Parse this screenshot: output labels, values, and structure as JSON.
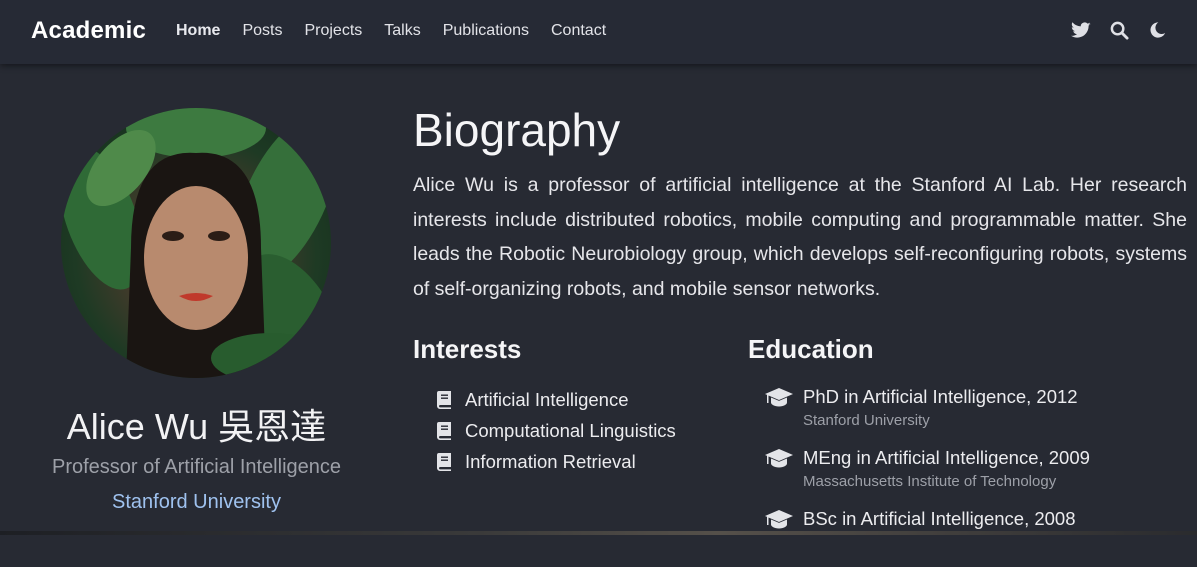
{
  "brand": "Academic",
  "nav": {
    "links": [
      "Home",
      "Posts",
      "Projects",
      "Talks",
      "Publications",
      "Contact"
    ],
    "active": "Home",
    "icons": [
      "twitter-icon",
      "search-icon",
      "moon-icon"
    ]
  },
  "profile": {
    "name": "Alice Wu 吳恩達",
    "role": "Professor of Artificial Intelligence",
    "organization": "Stanford University"
  },
  "biography": {
    "title": "Biography",
    "text": "Alice Wu is a professor of artificial intelligence at the Stanford AI Lab. Her research interests include distributed robotics, mobile computing and programmable matter. She leads the Robotic Neurobiology group, which develops self-reconfiguring robots, systems of self-organizing robots, and mobile sensor networks."
  },
  "interests": {
    "title": "Interests",
    "items": [
      "Artificial Intelligence",
      "Computational Linguistics",
      "Information Retrieval"
    ]
  },
  "education": {
    "title": "Education",
    "items": [
      {
        "course": "PhD in Artificial Intelligence, 2012",
        "institution": "Stanford University"
      },
      {
        "course": "MEng in Artificial Intelligence, 2009",
        "institution": "Massachusetts Institute of Technology"
      },
      {
        "course": "BSc in Artificial Intelligence, 2008",
        "institution": ""
      }
    ]
  },
  "colors": {
    "background": "#272a33",
    "navbar": "#262a35",
    "link_accent": "#9fc2ef",
    "muted_text": "#9da0a8"
  }
}
